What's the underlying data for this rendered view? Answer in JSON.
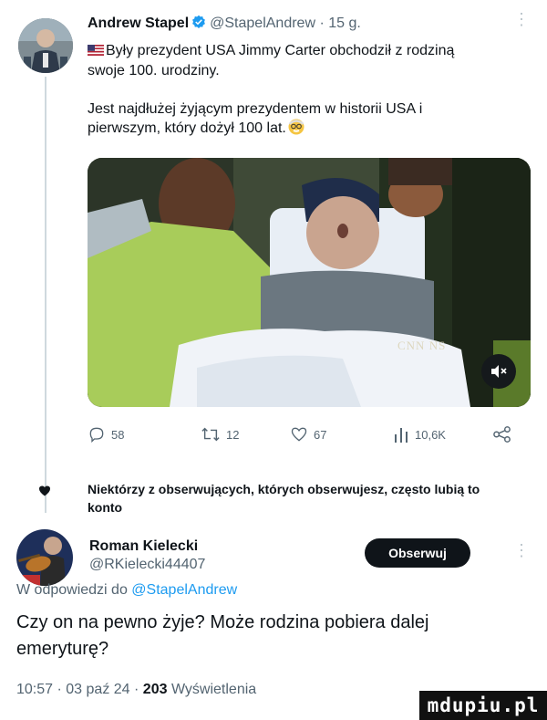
{
  "tweet": {
    "author_name": "Andrew Stapel",
    "author_handle": "@StapelAndrew",
    "time": "15 g.",
    "text_line1": "Były prezydent USA Jimmy Carter obchodził z rodziną",
    "text_line2": "swoje 100. urodziny.",
    "text_para2_line1": "Jest najdłużej żyjącym prezydentem w historii USA i",
    "text_para2_line2": "pierwszym, który dożył 100 lat.",
    "flag_icon": "us-flag-icon",
    "emoji_icon": "old-man-emoji-icon",
    "media_overlay_text": "CNN NS",
    "stats": {
      "replies": "58",
      "retweets": "12",
      "likes": "67",
      "views": "10,6K"
    }
  },
  "reply_restriction": {
    "line1": "Niektórzy z obserwujących, których obserwujesz, często lubią to",
    "line2": "konto"
  },
  "reply": {
    "author_name": "Roman Kielecki",
    "author_handle": "@RKielecki44407",
    "follow_label": "Obserwuj",
    "replying_prefix": "W odpowiedzi do",
    "replying_to": "@StapelAndrew",
    "text_line1": "Czy on na pewno żyje? Może rodzina pobiera dalej",
    "text_line2": "emeryturę?",
    "time": "10:57",
    "date": "03 paź 24",
    "views_count": "203",
    "views_label": "Wyświetlenia"
  },
  "watermark": "mdupiu.pl",
  "colors": {
    "text": "#0f1419",
    "muted": "#536471",
    "link": "#1d9bf0",
    "verified": "#1d9bf0"
  }
}
